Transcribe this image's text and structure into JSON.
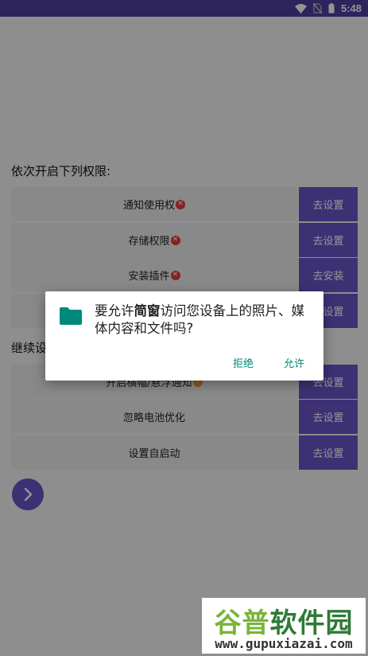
{
  "status_bar": {
    "time": "5:48",
    "icons": [
      "wifi-icon",
      "no-sim-icon",
      "battery-icon"
    ]
  },
  "sections": [
    {
      "title": "依次开启下列权限:",
      "rows": [
        {
          "label": "通知使用权",
          "status": "error",
          "button": "去设置"
        },
        {
          "label": "存储权限",
          "status": "error",
          "button": "去设置"
        },
        {
          "label": "安装插件",
          "status": "error",
          "button": "去安装"
        },
        {
          "label": "",
          "status": "",
          "button": "去设置"
        }
      ]
    },
    {
      "title": "继续设",
      "rows": [
        {
          "label": "开启横幅/悬浮通知",
          "status": "warning",
          "button": "去设置"
        },
        {
          "label": "忽略电池优化",
          "status": "",
          "button": "去设置"
        },
        {
          "label": "设置自启动",
          "status": "",
          "button": "去设置"
        }
      ]
    }
  ],
  "next_button": {
    "icon": "chevron-right-icon"
  },
  "dialog": {
    "msg_pre": "要允许",
    "app_name": "简窗",
    "msg_post": "访问您设备上的照片、媒体内容和文件吗?",
    "icon": "folder-icon",
    "deny_label": "拒绝",
    "allow_label": "允许"
  },
  "watermark": {
    "title_part1": "谷普",
    "title_part2": "软件园",
    "url": "www.gupuxiazai.com"
  },
  "colors": {
    "status_bar": "#4e3fa0",
    "accent": "#6a55c8",
    "dialog_action": "#00897b",
    "folder": "#00897b",
    "error": "#e53935",
    "warning": "#f39a2c"
  }
}
